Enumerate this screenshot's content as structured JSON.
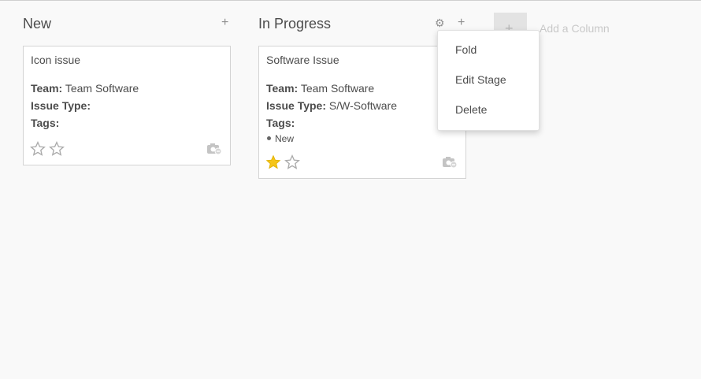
{
  "columns": [
    {
      "title": "New",
      "add_icon": "plus-icon",
      "cards": [
        {
          "title": "Icon issue",
          "team_label": "Team:",
          "team_value": "Team Software",
          "issue_type_label": "Issue Type:",
          "issue_type_value": "",
          "tags_label": "Tags:",
          "tags": [],
          "priority_stars": 0,
          "attachment_icon": "camera-icon"
        }
      ]
    },
    {
      "title": "In Progress",
      "settings_icon": "gear-icon",
      "add_icon": "plus-icon",
      "cards": [
        {
          "title": "Software Issue",
          "team_label": "Team:",
          "team_value": "Team Software",
          "issue_type_label": "Issue Type:",
          "issue_type_value": "S/W-Software",
          "tags_label": "Tags:",
          "tags": [
            "New"
          ],
          "priority_stars": 1,
          "attachment_icon": "camera-icon"
        }
      ]
    }
  ],
  "add_column": {
    "icon": "plus-icon",
    "label": "Add a Column"
  },
  "stage_menu": {
    "items": [
      "Fold",
      "Edit Stage",
      "Delete"
    ]
  },
  "colors": {
    "star_filled": "#f5c518",
    "star_empty": "#aaaaaa",
    "text": "#4c4c4c"
  }
}
